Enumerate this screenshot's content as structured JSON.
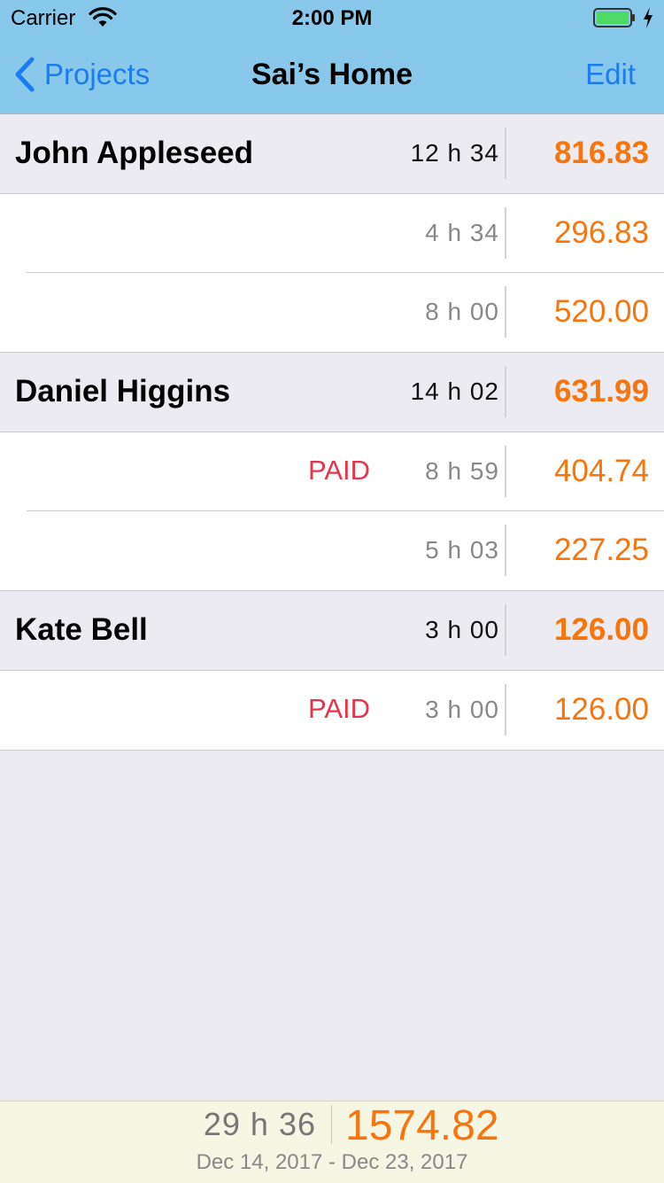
{
  "status_bar": {
    "carrier": "Carrier",
    "time": "2:00 PM",
    "battery_color": "#4cd964"
  },
  "nav": {
    "back_label": "Projects",
    "title": "Sai’s Home",
    "edit_label": "Edit",
    "tint_color": "#1a7cf0",
    "bar_color": "#88c9eb"
  },
  "groups": [
    {
      "name": "John Appleseed",
      "hours": "12 h 34",
      "amount": "816.83",
      "items": [
        {
          "status": "",
          "hours": "4 h 34",
          "amount": "296.83"
        },
        {
          "status": "",
          "hours": "8 h 00",
          "amount": "520.00"
        }
      ]
    },
    {
      "name": "Daniel Higgins",
      "hours": "14 h 02",
      "amount": "631.99",
      "items": [
        {
          "status": "PAID",
          "hours": "8 h 59",
          "amount": "404.74"
        },
        {
          "status": "",
          "hours": "5 h 03",
          "amount": "227.25"
        }
      ]
    },
    {
      "name": "Kate Bell",
      "hours": "3 h 00",
      "amount": "126.00",
      "items": [
        {
          "status": "PAID",
          "hours": "3 h 00",
          "amount": "126.00"
        }
      ]
    }
  ],
  "footer": {
    "total_hours": "29 h 36",
    "total_amount": "1574.82",
    "date_range": "Dec 14, 2017 - Dec 23, 2017"
  },
  "colors": {
    "amount": "#f7750c",
    "paid": "#e6344a"
  }
}
